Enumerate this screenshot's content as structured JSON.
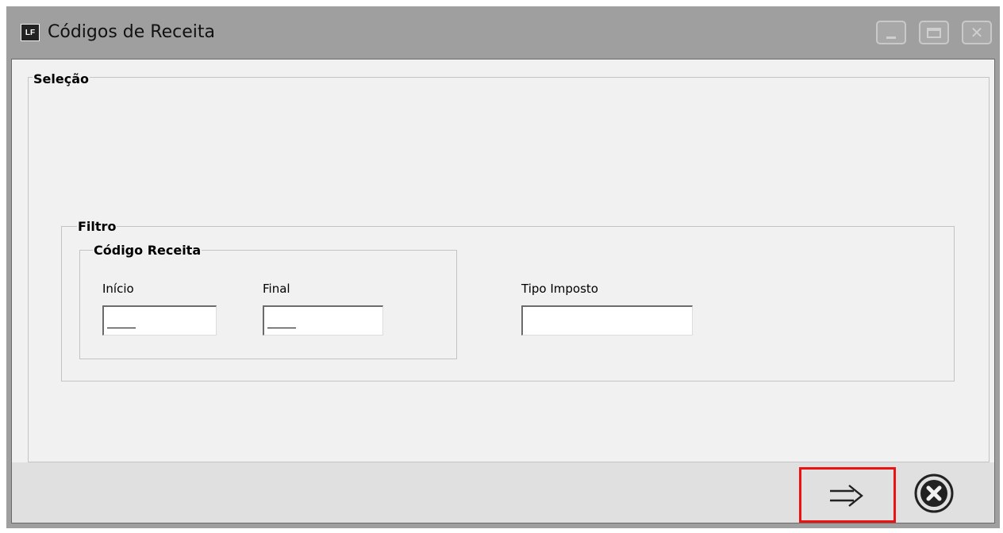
{
  "window": {
    "app_icon_text": "LF",
    "title": "Códigos de Receita"
  },
  "selecao": {
    "label": "Seleção"
  },
  "filtro": {
    "label": "Filtro",
    "codigo_receita": {
      "label": "Código Receita",
      "inicio": {
        "label": "Início",
        "value": ""
      },
      "final": {
        "label": "Final",
        "value": ""
      }
    },
    "tipo_imposto": {
      "label": "Tipo Imposto",
      "value": ""
    }
  },
  "footer": {
    "next_icon": "arrow-right-icon",
    "cancel_icon": "close-circle-icon",
    "highlight_color": "#ee1111"
  }
}
